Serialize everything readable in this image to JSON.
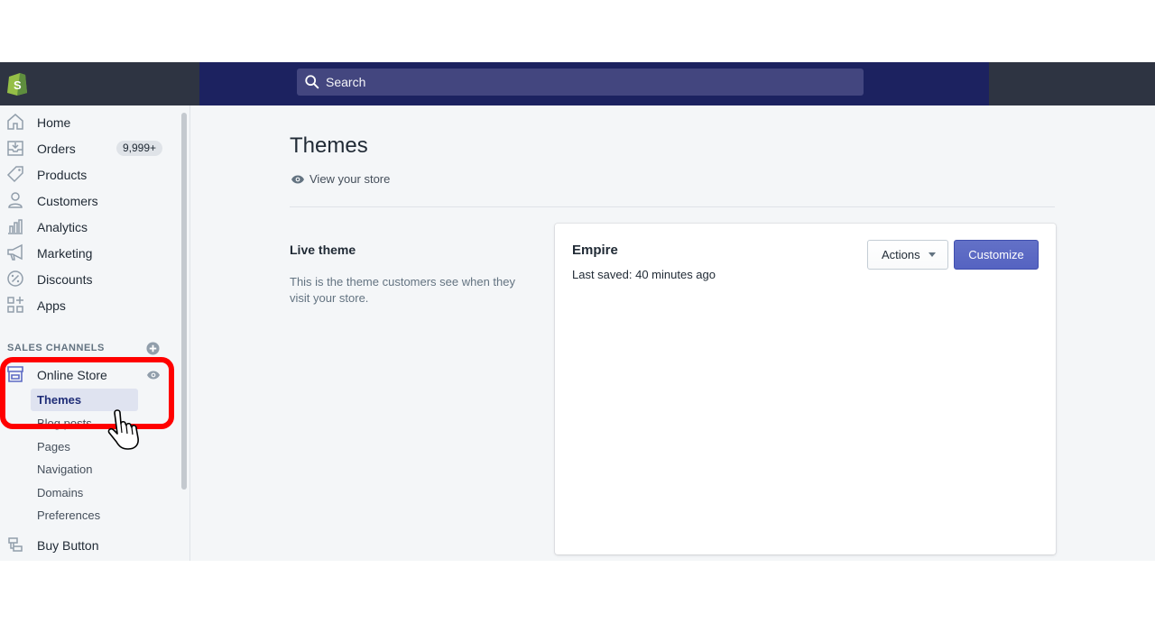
{
  "topbar": {
    "search_placeholder": "Search"
  },
  "sidebar": {
    "items": [
      {
        "label": "Home",
        "icon": "home-icon"
      },
      {
        "label": "Orders",
        "icon": "orders-icon",
        "badge": "9,999+"
      },
      {
        "label": "Products",
        "icon": "tag-icon"
      },
      {
        "label": "Customers",
        "icon": "person-icon"
      },
      {
        "label": "Analytics",
        "icon": "chart-icon"
      },
      {
        "label": "Marketing",
        "icon": "megaphone-icon"
      },
      {
        "label": "Discounts",
        "icon": "discount-icon"
      },
      {
        "label": "Apps",
        "icon": "apps-icon"
      }
    ],
    "sales_channels_heading": "SALES CHANNELS",
    "online_store": {
      "label": "Online Store",
      "sub_items": [
        "Themes",
        "Blog posts",
        "Pages",
        "Navigation",
        "Domains",
        "Preferences"
      ],
      "active_sub_item": "Themes"
    },
    "buy_button_label": "Buy Button"
  },
  "main": {
    "title": "Themes",
    "view_store_label": "View your store",
    "live_theme": {
      "heading": "Live theme",
      "description": "This is the theme customers see when they visit your store."
    },
    "card": {
      "theme_name": "Empire",
      "last_saved": "Last saved: 40 minutes ago",
      "actions_label": "Actions",
      "customize_label": "Customize"
    }
  },
  "colors": {
    "topbar": "#1c2260",
    "logo_area": "#2e3442",
    "search_bg": "#43467f",
    "accent": "#5c6ac4",
    "annotation": "#ff0000"
  }
}
